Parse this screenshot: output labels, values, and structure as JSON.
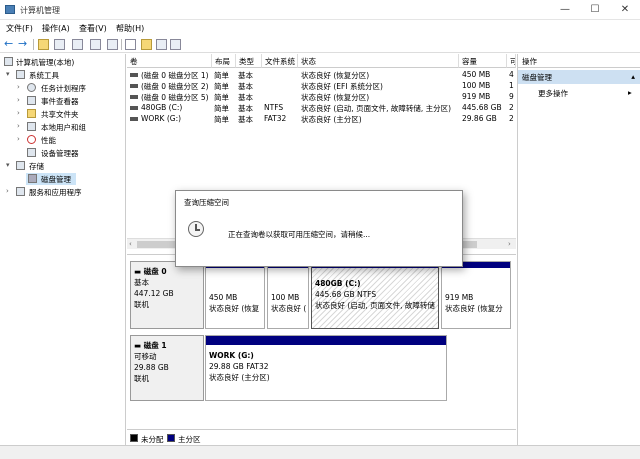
{
  "window": {
    "title": "计算机管理",
    "controls": {
      "minimize": "—",
      "maximize": "☐",
      "close": "✕"
    }
  },
  "menu": [
    "文件(F)",
    "操作(A)",
    "查看(V)",
    "帮助(H)"
  ],
  "toolbar": {
    "back": "←",
    "forward": "→"
  },
  "tree": {
    "root": "计算机管理(本地)",
    "system_tools": "系统工具",
    "task_scheduler": "任务计划程序",
    "event_viewer": "事件查看器",
    "shared_folders": "共享文件夹",
    "local_users": "本地用户和组",
    "performance": "性能",
    "device_manager": "设备管理器",
    "storage": "存储",
    "disk_management": "磁盘管理",
    "services_apps": "服务和应用程序"
  },
  "volumes": {
    "columns": [
      "卷",
      "布局",
      "类型",
      "文件系统",
      "状态",
      "容量",
      "可"
    ],
    "rows": [
      {
        "name": "(磁盘 0 磁盘分区 1)",
        "layout": "简单",
        "type": "基本",
        "fs": "",
        "status": "状态良好 (恢复分区)",
        "capacity": "450 MB",
        "free": "4"
      },
      {
        "name": "(磁盘 0 磁盘分区 2)",
        "layout": "简单",
        "type": "基本",
        "fs": "",
        "status": "状态良好 (EFI 系统分区)",
        "capacity": "100 MB",
        "free": "1"
      },
      {
        "name": "(磁盘 0 磁盘分区 5)",
        "layout": "简单",
        "type": "基本",
        "fs": "",
        "status": "状态良好 (恢复分区)",
        "capacity": "919 MB",
        "free": "9"
      },
      {
        "name": "480GB (C:)",
        "layout": "简单",
        "type": "基本",
        "fs": "NTFS",
        "status": "状态良好 (启动, 页面文件, 故障转储, 主分区)",
        "capacity": "445.68 GB",
        "free": "2"
      },
      {
        "name": "WORK (G:)",
        "layout": "简单",
        "type": "基本",
        "fs": "FAT32",
        "status": "状态良好 (主分区)",
        "capacity": "29.86 GB",
        "free": "2"
      }
    ]
  },
  "disks": [
    {
      "label": "磁盘 0",
      "type": "基本",
      "size": "447.12 GB",
      "state": "联机",
      "partitions": [
        {
          "title": "",
          "size": "450 MB",
          "status": "状态良好 (恢复"
        },
        {
          "title": "",
          "size": "100 MB",
          "status": "状态良好 ("
        },
        {
          "title": "480GB (C:)",
          "size": "445.68 GB NTFS",
          "status": "状态良好 (启动, 页面文件, 故障转储"
        },
        {
          "title": "",
          "size": "919 MB",
          "status": "状态良好 (恢复分"
        }
      ]
    },
    {
      "label": "磁盘 1",
      "type": "可移动",
      "size": "29.88 GB",
      "state": "联机",
      "partitions": [
        {
          "title": "WORK (G:)",
          "size": "29.88 GB FAT32",
          "status": "状态良好 (主分区)"
        }
      ]
    }
  ],
  "legend": {
    "unallocated": "未分配",
    "primary": "主分区"
  },
  "actions": {
    "header": "操作",
    "section": "磁盘管理",
    "more": "更多操作",
    "more_arrow": "▸"
  },
  "dialog": {
    "title": "查询压缩空间",
    "message": "正在查询卷以获取可用压缩空间，请稍候..."
  },
  "colors": {
    "primary_partition": "#00007f",
    "selection": "#cce4f7",
    "action_section": "#cde0f2"
  }
}
